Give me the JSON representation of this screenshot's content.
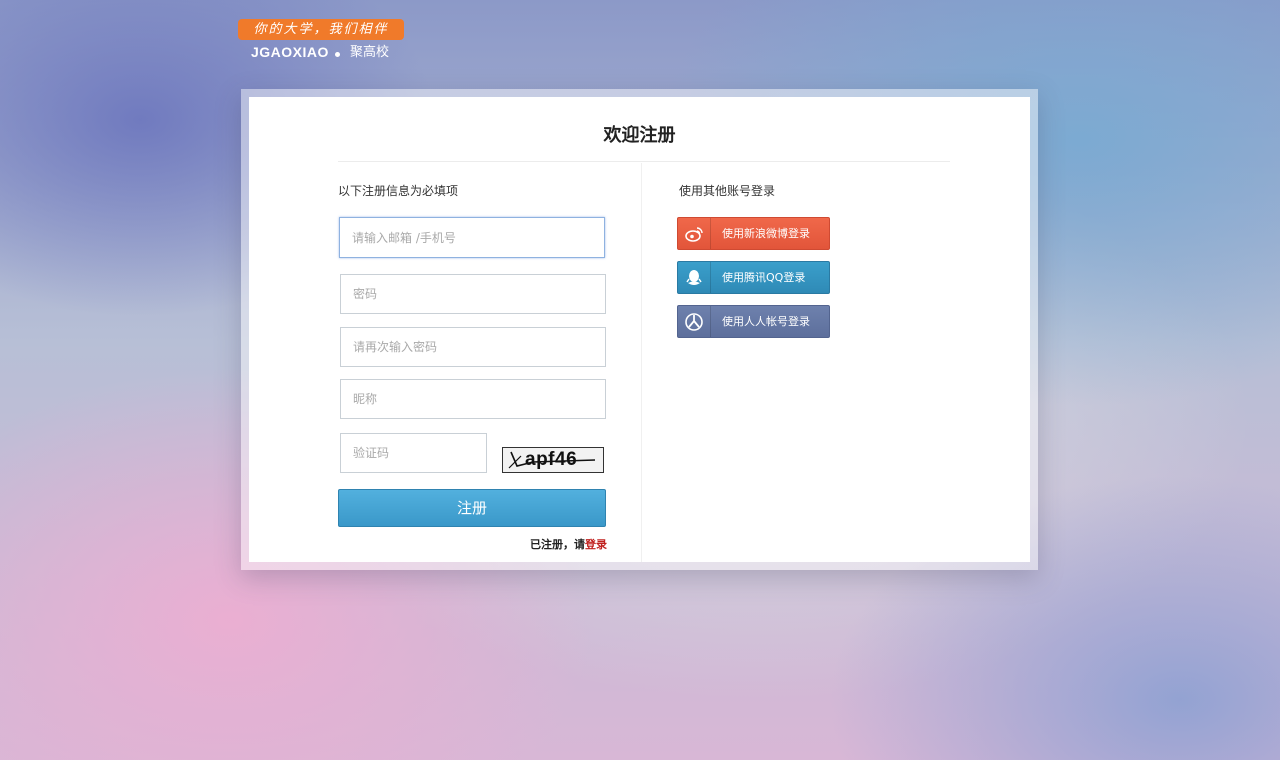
{
  "logo": {
    "slogan": "你的大学，我们相伴",
    "brand": "JGAOXIAO",
    "brand_cn": "聚高校"
  },
  "page": {
    "title": "欢迎注册"
  },
  "form": {
    "hint": "以下注册信息为必填项",
    "email_placeholder": "请输入邮箱 /手机号",
    "password_placeholder": "密码",
    "password_confirm_placeholder": "请再次输入密码",
    "nickname_placeholder": "昵称",
    "captcha_placeholder": "验证码",
    "captcha_text": "apf46",
    "register_label": "注册",
    "already_registered": "已注册，请",
    "login_link": "登录"
  },
  "social": {
    "hint": "使用其他账号登录",
    "buttons": [
      {
        "label": "使用新浪微博登录",
        "icon": "weibo-icon",
        "color": "#e95a3e"
      },
      {
        "label": "使用腾讯QQ登录",
        "icon": "qq-icon",
        "color": "#3296c1"
      },
      {
        "label": "使用人人帐号登录",
        "icon": "renren-icon",
        "color": "#6577a4"
      }
    ]
  }
}
